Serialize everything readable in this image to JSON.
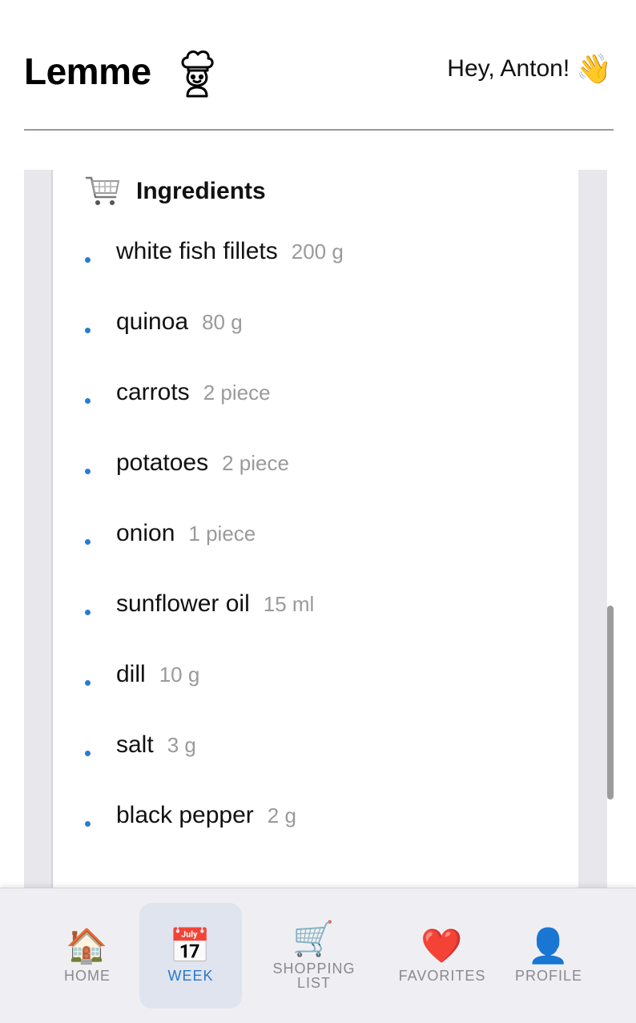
{
  "header": {
    "app_name": "Lemme",
    "greeting": "Hey, Anton!",
    "wave_emoji": "👋"
  },
  "ingredients": {
    "title": "Ingredients",
    "items": [
      {
        "name": "white fish fillets",
        "qty": "200 g"
      },
      {
        "name": "quinoa",
        "qty": "80 g"
      },
      {
        "name": "carrots",
        "qty": "2 piece"
      },
      {
        "name": "potatoes",
        "qty": "2 piece"
      },
      {
        "name": "onion",
        "qty": "1 piece"
      },
      {
        "name": "sunflower oil",
        "qty": "15 ml"
      },
      {
        "name": "dill",
        "qty": "10 g"
      },
      {
        "name": "salt",
        "qty": "3 g"
      },
      {
        "name": "black pepper",
        "qty": "2 g"
      }
    ]
  },
  "nav": {
    "items": [
      {
        "label": "Home",
        "icon": "🏠",
        "active": false
      },
      {
        "label": "Week",
        "icon": "📅",
        "active": true
      },
      {
        "label": "Shopping list",
        "icon": "🛒",
        "active": false
      },
      {
        "label": "Favorites",
        "icon": "❤️",
        "active": false
      },
      {
        "label": "Profile",
        "icon": "👤",
        "active": false
      }
    ]
  },
  "colors": {
    "accent": "#2b78c6",
    "bullet": "#2b7bd0",
    "muted": "#9a9a9a",
    "nav_active_bg": "#dfe4ef"
  }
}
